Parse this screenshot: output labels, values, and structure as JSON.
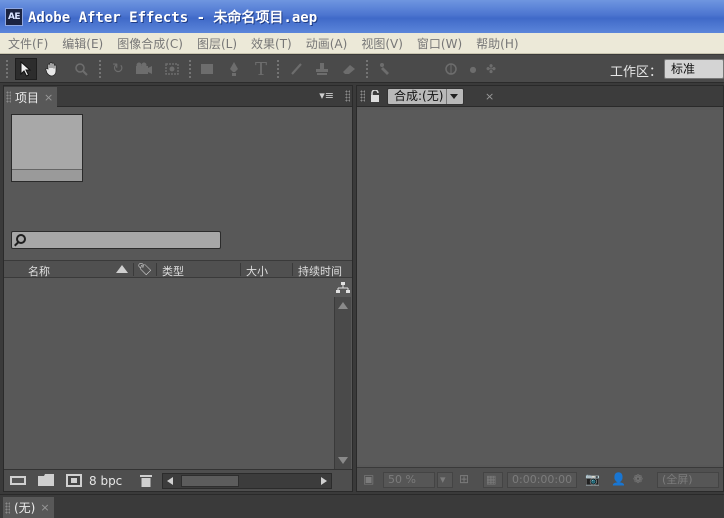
{
  "window": {
    "title": "Adobe After Effects - 未命名项目.aep",
    "icon_label": "AE"
  },
  "menu": [
    {
      "label": "文件(F)"
    },
    {
      "label": "编辑(E)"
    },
    {
      "label": "图像合成(C)"
    },
    {
      "label": "图层(L)"
    },
    {
      "label": "效果(T)"
    },
    {
      "label": "动画(A)"
    },
    {
      "label": "视图(V)"
    },
    {
      "label": "窗口(W)"
    },
    {
      "label": "帮助(H)"
    }
  ],
  "toolbar": {
    "workspace_label": "工作区：",
    "workspace_value": "标准",
    "tools": [
      "selection-tool",
      "hand-tool",
      "zoom-tool",
      "rotate-tool",
      "camera-tool",
      "pan-behind-tool",
      "rectangle-tool",
      "pen-tool",
      "text-tool",
      "brush-tool",
      "clone-stamp-tool",
      "eraser-tool",
      "puppet-tool",
      "local-axis-tool"
    ]
  },
  "project_panel": {
    "tab_label": "项目",
    "menu_glyph": "▾≡",
    "search_placeholder": "",
    "columns": {
      "name": "名称",
      "type": "类型",
      "size": "大小",
      "duration": "持续时间"
    },
    "bpc_label": "8 bpc"
  },
  "comp_panel": {
    "dropdown_label": "合成:(无)",
    "zoom": "50 %",
    "timecode": "0:00:00:00",
    "resolution": "(全屏)"
  },
  "timeline": {
    "tab_label": "(无)"
  },
  "glyphs": {
    "close": "×"
  },
  "colors": {
    "titlebar": "#4c75d0",
    "panel_bg": "#585858",
    "menubar": "#ece9d8"
  }
}
